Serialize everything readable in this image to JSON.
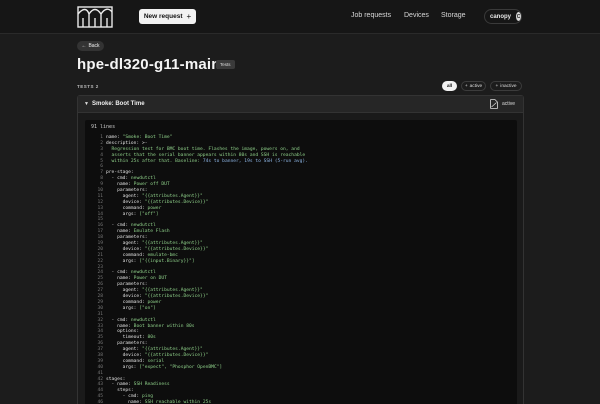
{
  "topbar": {
    "new_request": "New request",
    "nav": [
      "Job requests",
      "Devices",
      "Storage"
    ],
    "org": "canopy",
    "avatar": "C"
  },
  "back_label": "Back",
  "page_title": "hpe-dl320-g11-main",
  "page_tag": "Tests",
  "tests_label": "TESTS 2",
  "filters": {
    "all": "all",
    "active": "active",
    "inactive": "inactive"
  },
  "card": {
    "name": "Smoke: Boot Time",
    "status": "active",
    "line_count": "91 lines",
    "lines": [
      [
        {
          "t": "name: "
        },
        {
          "t": "\"Smoke: Boot Time\"",
          "c": "s"
        }
      ],
      [
        {
          "t": "description: >-"
        }
      ],
      [
        {
          "t": "  Regression test for BMC boot time. Flashes the image, powers on, and",
          "c": "s"
        }
      ],
      [
        {
          "t": "  asserts that the serial banner appears within 80s and SSH is reachable",
          "c": "s"
        }
      ],
      [
        {
          "t": "  within 25s after that. Baseline: ",
          "c": "s"
        },
        {
          "t": "74s to banner, 19s to SSH (5-run avg).",
          "c": "b"
        }
      ],
      [
        {
          "t": ""
        }
      ],
      [
        {
          "t": "pre-stage:"
        }
      ],
      [
        {
          "t": "  - cmd: "
        },
        {
          "t": "newdutctl",
          "c": "s"
        }
      ],
      [
        {
          "t": "    name: "
        },
        {
          "t": "Power off DUT",
          "c": "s"
        }
      ],
      [
        {
          "t": "    parameters:"
        }
      ],
      [
        {
          "t": "      agent: "
        },
        {
          "t": "\"{{attributes.Agent}}\"",
          "c": "s"
        }
      ],
      [
        {
          "t": "      device: "
        },
        {
          "t": "\"{{attributes.Device}}\"",
          "c": "s"
        }
      ],
      [
        {
          "t": "      command: "
        },
        {
          "t": "power",
          "c": "s"
        }
      ],
      [
        {
          "t": "      args: "
        },
        {
          "t": "[\"off\"]",
          "c": "s"
        }
      ],
      [
        {
          "t": ""
        }
      ],
      [
        {
          "t": "  - cmd: "
        },
        {
          "t": "newdutctl",
          "c": "s"
        }
      ],
      [
        {
          "t": "    name: "
        },
        {
          "t": "Emulate Flash",
          "c": "s"
        }
      ],
      [
        {
          "t": "    parameters:"
        }
      ],
      [
        {
          "t": "      agent: "
        },
        {
          "t": "\"{{attributes.Agent}}\"",
          "c": "s"
        }
      ],
      [
        {
          "t": "      device: "
        },
        {
          "t": "\"{{attributes.Device}}\"",
          "c": "s"
        }
      ],
      [
        {
          "t": "      command: "
        },
        {
          "t": "emulate-bmc",
          "c": "s"
        }
      ],
      [
        {
          "t": "      args: "
        },
        {
          "t": "[\"{{input.Binary}}\"]",
          "c": "s"
        }
      ],
      [
        {
          "t": ""
        }
      ],
      [
        {
          "t": "  - cmd: "
        },
        {
          "t": "newdutctl",
          "c": "s"
        }
      ],
      [
        {
          "t": "    name: "
        },
        {
          "t": "Power on DUT",
          "c": "s"
        }
      ],
      [
        {
          "t": "    parameters:"
        }
      ],
      [
        {
          "t": "      agent: "
        },
        {
          "t": "\"{{attributes.Agent}}\"",
          "c": "s"
        }
      ],
      [
        {
          "t": "      device: "
        },
        {
          "t": "\"{{attributes.Device}}\"",
          "c": "s"
        }
      ],
      [
        {
          "t": "      command: "
        },
        {
          "t": "power",
          "c": "s"
        }
      ],
      [
        {
          "t": "      args: "
        },
        {
          "t": "[\"on\"]",
          "c": "s"
        }
      ],
      [
        {
          "t": ""
        }
      ],
      [
        {
          "t": "  - cmd: "
        },
        {
          "t": "newdutctl",
          "c": "s"
        }
      ],
      [
        {
          "t": "    name: "
        },
        {
          "t": "Boot banner within 80s",
          "c": "s"
        }
      ],
      [
        {
          "t": "    options:"
        }
      ],
      [
        {
          "t": "      timeout: "
        },
        {
          "t": "80s",
          "c": "s"
        }
      ],
      [
        {
          "t": "    parameters:"
        }
      ],
      [
        {
          "t": "      agent: "
        },
        {
          "t": "\"{{attributes.Agent}}\"",
          "c": "s"
        }
      ],
      [
        {
          "t": "      device: "
        },
        {
          "t": "\"{{attributes.Device}}\"",
          "c": "s"
        }
      ],
      [
        {
          "t": "      command: "
        },
        {
          "t": "serial",
          "c": "s"
        }
      ],
      [
        {
          "t": "      args: "
        },
        {
          "t": "[\"expect\", \"Phosphor OpenBMC\"]",
          "c": "s"
        }
      ],
      [
        {
          "t": ""
        }
      ],
      [
        {
          "t": "stages:"
        }
      ],
      [
        {
          "t": "  - name: "
        },
        {
          "t": "SSH Readiness",
          "c": "s"
        }
      ],
      [
        {
          "t": "    steps:"
        }
      ],
      [
        {
          "t": "      - cmd: "
        },
        {
          "t": "ping",
          "c": "s"
        }
      ],
      [
        {
          "t": "        name: "
        },
        {
          "t": "SSH reachable within 25s",
          "c": "s"
        }
      ],
      [
        {
          "t": "        options:"
        }
      ]
    ]
  }
}
